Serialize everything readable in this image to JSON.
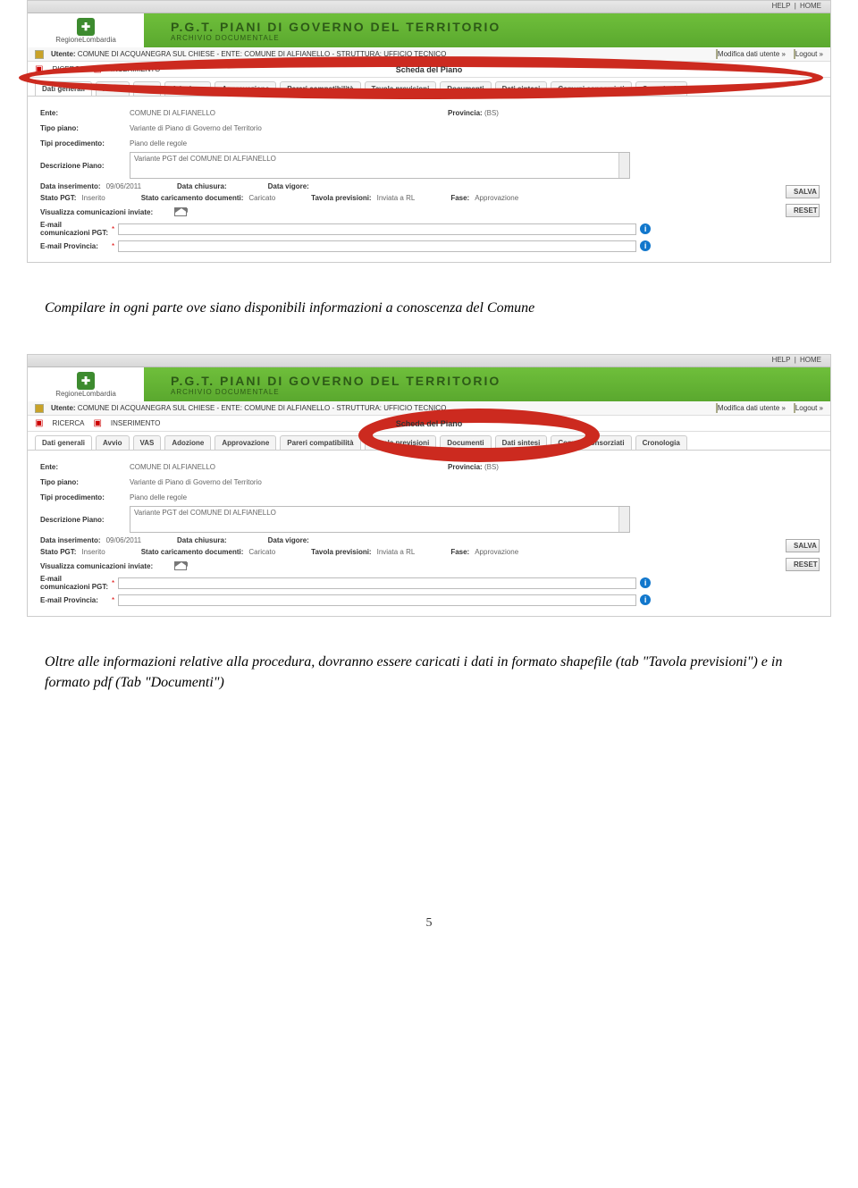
{
  "topbar": {
    "help": "HELP",
    "home": "HOME"
  },
  "brand": {
    "region": "RegioneLombardia",
    "title": "P.G.T. PIANI DI GOVERNO DEL TERRITORIO",
    "subtitle": "ARCHIVIO DOCUMENTALE"
  },
  "userbar": {
    "utente_label": "Utente:",
    "utente1": "COMUNE DI ACQUANEGRA SUL CHIESE - ENTE: COMUNE DI ALFIANELLO - STRUTTURA: UFFICIO TECNICO",
    "modifica": "Modifica dati utente »",
    "logout": "Logout »"
  },
  "navbar": {
    "ricerca": "RICERCA",
    "inserimento": "INSERIMENTO",
    "scheda": "Scheda del Piano"
  },
  "tabs": [
    "Dati generali",
    "Avvio",
    "VAS",
    "Adozione",
    "Approvazione",
    "Pareri compatibilità",
    "Tavola previsioni",
    "Documenti",
    "Dati sintesi",
    "Comuni consorziati",
    "Cronologia"
  ],
  "form": {
    "ente_lbl": "Ente:",
    "ente_val": "COMUNE DI ALFIANELLO",
    "prov_lbl": "Provincia:",
    "prov_val": "(BS)",
    "tipopiano_lbl": "Tipo piano:",
    "tipopiano_val": "Variante di Piano di Governo del Territorio",
    "tipiproc_lbl": "Tipi procedimento:",
    "tipiproc_val": "Piano delle regole",
    "descr_lbl": "Descrizione Piano:",
    "descr_val": "Variante PGT del COMUNE DI ALFIANELLO",
    "datains_lbl": "Data inserimento:",
    "datains_val": "09/06/2011",
    "datachiu_lbl": "Data chiusura:",
    "datachiu_val": "",
    "datavig_lbl": "Data vigore:",
    "datavig_val": "",
    "statopgt_lbl": "Stato PGT:",
    "statopgt_val": "Inserito",
    "statocaric_lbl": "Stato caricamento documenti:",
    "statocaric_val": "Caricato",
    "tavprev_lbl": "Tavola previsioni:",
    "tavprev_val": "Inviata a RL",
    "fase_lbl": "Fase:",
    "fase_val": "Approvazione",
    "viscom_lbl": "Visualizza comunicazioni inviate:",
    "empgt_lbl": "E-mail comunicazioni PGT:",
    "emprov_lbl": "E-mail Provincia:",
    "salva": "SALVA",
    "reset": "RESET"
  },
  "body": {
    "p1": "Compilare in ogni parte ove siano disponibili informazioni a conoscenza del Comune",
    "p2": "Oltre alle informazioni relative alla procedura, dovranno essere caricati i dati in formato shapefile (tab \"Tavola previsioni\") e in formato pdf (Tab \"Documenti\")"
  },
  "page_number": "5"
}
